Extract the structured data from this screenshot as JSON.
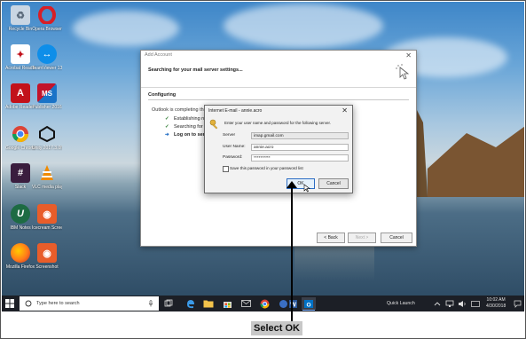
{
  "desktop_icons": [
    {
      "label": "Recycle Bin",
      "icon": "recycle-bin-icon",
      "color": "#c9d6e3"
    },
    {
      "label": "Opera Browser",
      "icon": "opera-icon",
      "color": "#d81f26"
    },
    {
      "label": "Acrobat Reader DC",
      "icon": "acrobat-icon",
      "color": "#ffffff"
    },
    {
      "label": "TeamViewer 13",
      "icon": "teamviewer-icon",
      "color": "#0e8ee9"
    },
    {
      "label": "Adobe Reader 9",
      "icon": "adobe-reader-icon",
      "color": "#c2121b"
    },
    {
      "label": "Publisher 2016",
      "icon": "ms-office-icon",
      "color": "#c2142b"
    },
    {
      "label": "Google Chrome",
      "icon": "chrome-icon",
      "color": "#ffffff"
    },
    {
      "label": "Unity 2017.3.0f3",
      "icon": "unity-icon",
      "color": "#111111"
    },
    {
      "label": "Slack",
      "icon": "slack-icon",
      "color": "#3a1d3e"
    },
    {
      "label": "VLC media player",
      "icon": "vlc-icon",
      "color": "#f08a00"
    },
    {
      "label": "IBM Notes",
      "icon": "notes-icon",
      "color": "#1d6b43"
    },
    {
      "label": "Icecream Screen...",
      "icon": "screen-recorder-icon",
      "color": "#e85d2a"
    },
    {
      "label": "Mozilla Firefox",
      "icon": "firefox-icon",
      "color": "#ff7a1a"
    },
    {
      "label": "Screenshot",
      "icon": "screenshot-icon",
      "color": "#e85d2a"
    }
  ],
  "add_account": {
    "title": "Add Account",
    "heading": "Searching for your mail server settings...",
    "section": "Configuring",
    "progress_text": "Outlook is completing the setup for your account. This might take several minutes.",
    "steps": [
      {
        "mark": "check",
        "text": "Establishing network connection"
      },
      {
        "mark": "check",
        "text": "Searching for annie.acro settings"
      },
      {
        "mark": "arrow",
        "text": "Log on to server"
      }
    ],
    "buttons": {
      "back": "< Back",
      "next": "Next >",
      "cancel": "Cancel"
    }
  },
  "password_dialog": {
    "title": "Internet E-mail - annie.acro",
    "prompt": "Enter your user name and password for the following server.",
    "server_label": "Server",
    "server_value": "imap.gmail.com",
    "username_label": "User Name:",
    "username_value": "annie.acro",
    "password_label": "Password:",
    "password_value": "**********",
    "save_label": "Save this password in your password list",
    "ok_label": "OK",
    "cancel_label": "Cancel"
  },
  "taskbar": {
    "search_placeholder": "Type here to search",
    "quick_launch": "Quick Launch",
    "time": "10:02 AM",
    "date": "4/30/2018"
  },
  "callout": {
    "text": "Select OK"
  },
  "colors": {
    "taskbar": "#1c1f26",
    "accent": "#2b6cc4",
    "caption_bg": "#c8c8c8"
  }
}
